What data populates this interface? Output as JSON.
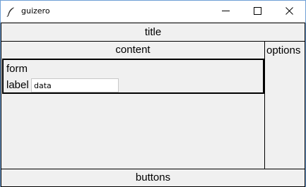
{
  "window": {
    "title": "guizero",
    "controls": {
      "minimize_icon": "minimize-icon",
      "maximize_icon": "maximize-icon",
      "close_icon": "close-icon"
    }
  },
  "layout": {
    "title_frame_label": "title",
    "content_frame_label": "content",
    "options_frame_label": "options",
    "buttons_frame_label": "buttons"
  },
  "form": {
    "heading": "form",
    "field_label": "label",
    "field_value": "data"
  },
  "colors": {
    "titlebar_bg": "#ffffff",
    "window_bg": "#f0f0f0",
    "window_border": "#6f9fd6",
    "frame_border": "#000000"
  }
}
